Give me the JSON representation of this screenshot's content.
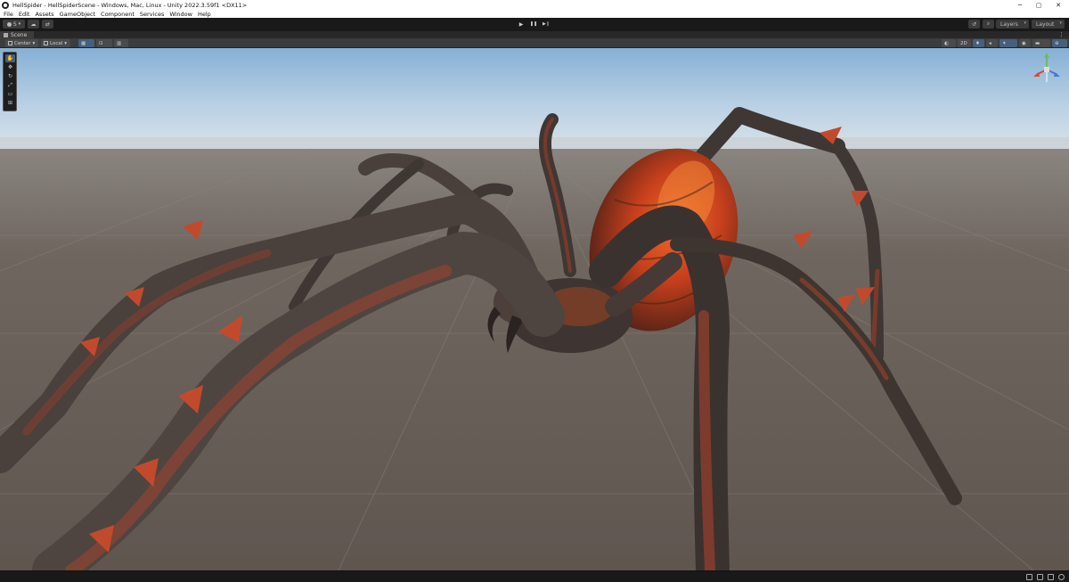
{
  "window": {
    "title": "HellSpider - HellSpiderScene - Windows, Mac, Linux - Unity 2022.3.59f1 <DX11>",
    "controls": {
      "minimize": "─",
      "maximize": "▢",
      "close": "✕"
    }
  },
  "menu": [
    "File",
    "Edit",
    "Assets",
    "GameObject",
    "Component",
    "Services",
    "Window",
    "Help"
  ],
  "toolbar": {
    "account_label": "S",
    "layers_label": "Layers",
    "layout_label": "Layout",
    "play": "▶",
    "pause": "❚❚",
    "step": "▶❙"
  },
  "scene_tab": {
    "label": "Scene"
  },
  "scene_toolbar": {
    "pivot_label": "Center",
    "space_label": "Local",
    "mode_2d_label": "2D"
  },
  "scene_tools": [
    "hand",
    "move",
    "rotate",
    "scale",
    "rect",
    "transform"
  ],
  "colors": {
    "editor_bg": "#191919",
    "toolbar_bg": "#3c3c3c",
    "selected": "#46607c",
    "sky_top": "#8fb6d8",
    "ground": "#6d645c",
    "lava": "#e0501e"
  }
}
